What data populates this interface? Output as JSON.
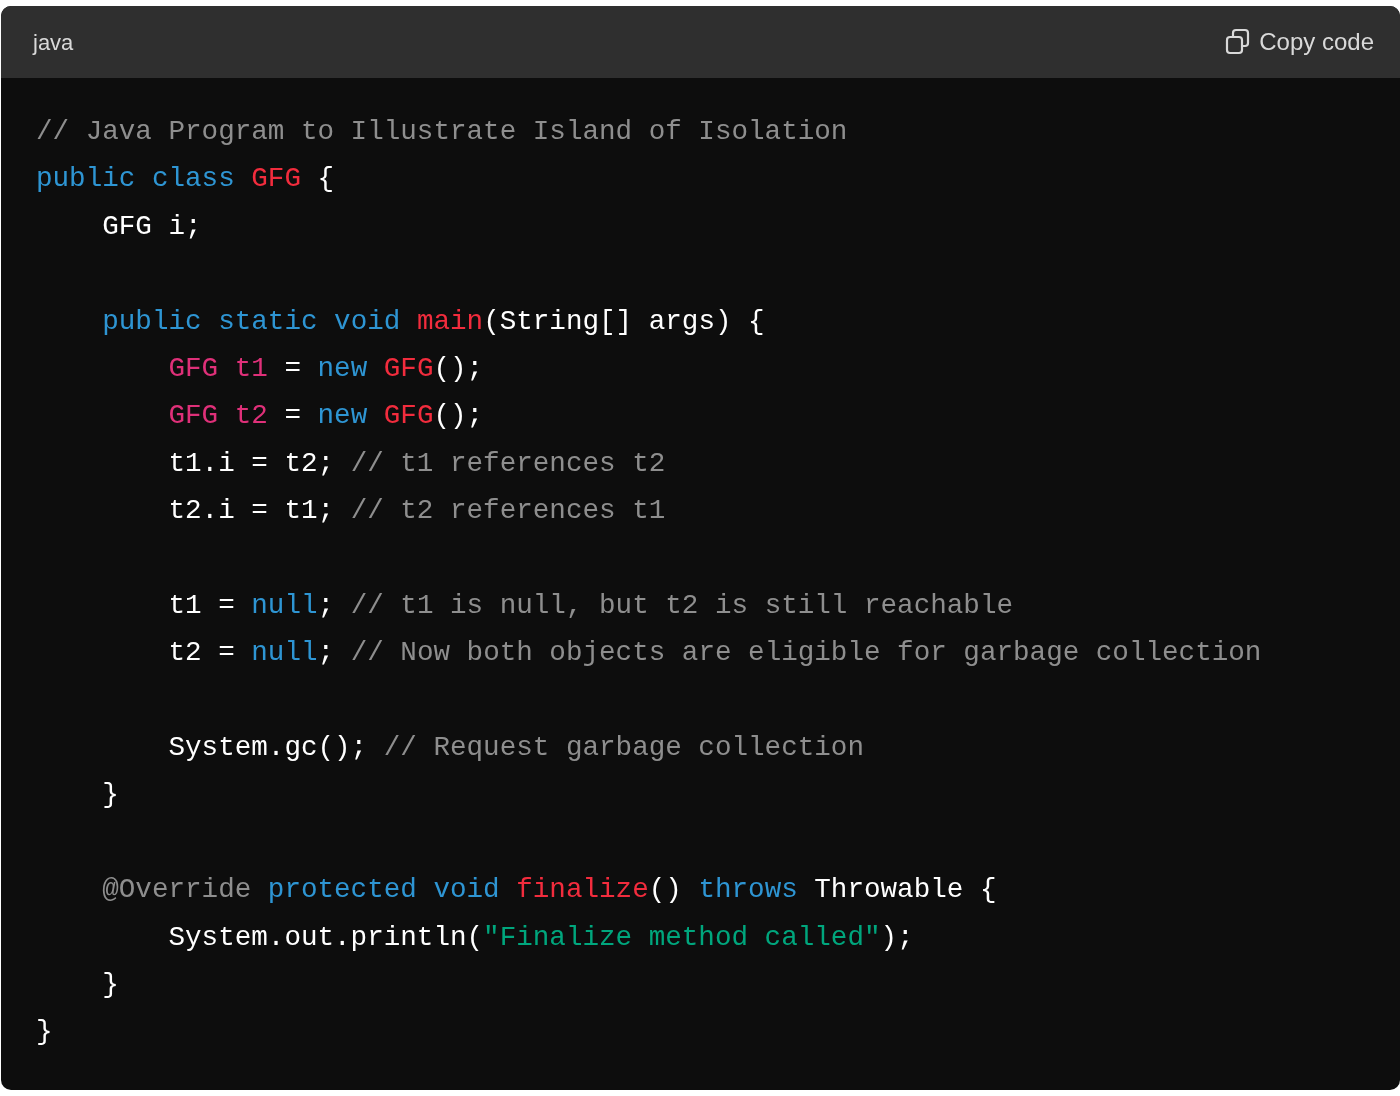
{
  "header": {
    "language": "java",
    "copy_button": "Copy code"
  },
  "code_lines": [
    {
      "kind": "code",
      "tokens": [
        {
          "kind": "comment",
          "text": "// Java Program to Illustrate Island of Isolation"
        }
      ]
    },
    {
      "kind": "code",
      "tokens": [
        {
          "kind": "keyword",
          "text": "public "
        },
        {
          "kind": "keyword",
          "text": "class "
        },
        {
          "kind": "name",
          "text": "GFG"
        },
        {
          "kind": "plain",
          "text": " {"
        }
      ]
    },
    {
      "kind": "code",
      "tokens": [
        {
          "kind": "plain",
          "text": "    GFG i;"
        }
      ]
    },
    {
      "kind": "blank"
    },
    {
      "kind": "code",
      "tokens": [
        {
          "kind": "keyword",
          "text": "    public "
        },
        {
          "kind": "keyword",
          "text": "static "
        },
        {
          "kind": "keyword",
          "text": "void "
        },
        {
          "kind": "name",
          "text": "main"
        },
        {
          "kind": "plain",
          "text": "(String[] args) {"
        }
      ]
    },
    {
      "kind": "code",
      "tokens": [
        {
          "kind": "variable",
          "text": "        GFG t1"
        },
        {
          "kind": "plain",
          "text": " = "
        },
        {
          "kind": "keyword",
          "text": "new "
        },
        {
          "kind": "name",
          "text": "GFG"
        },
        {
          "kind": "plain",
          "text": "();"
        }
      ]
    },
    {
      "kind": "code",
      "tokens": [
        {
          "kind": "variable",
          "text": "        GFG t2"
        },
        {
          "kind": "plain",
          "text": " = "
        },
        {
          "kind": "keyword",
          "text": "new "
        },
        {
          "kind": "name",
          "text": "GFG"
        },
        {
          "kind": "plain",
          "text": "();"
        }
      ]
    },
    {
      "kind": "code",
      "tokens": [
        {
          "kind": "plain",
          "text": "        t1.i = t2; "
        },
        {
          "kind": "comment",
          "text": "// t1 references t2"
        }
      ]
    },
    {
      "kind": "code",
      "tokens": [
        {
          "kind": "plain",
          "text": "        t2.i = t1; "
        },
        {
          "kind": "comment",
          "text": "// t2 references t1"
        }
      ]
    },
    {
      "kind": "blank"
    },
    {
      "kind": "code",
      "tokens": [
        {
          "kind": "plain",
          "text": "        t1 = "
        },
        {
          "kind": "keyword",
          "text": "null"
        },
        {
          "kind": "plain",
          "text": "; "
        },
        {
          "kind": "comment",
          "text": "// t1 is null, but t2 is still reachable"
        }
      ]
    },
    {
      "kind": "code",
      "tokens": [
        {
          "kind": "plain",
          "text": "        t2 = "
        },
        {
          "kind": "keyword",
          "text": "null"
        },
        {
          "kind": "plain",
          "text": "; "
        },
        {
          "kind": "comment",
          "text": "// Now both objects are eligible for garbage collection"
        }
      ]
    },
    {
      "kind": "blank"
    },
    {
      "kind": "code",
      "tokens": [
        {
          "kind": "plain",
          "text": "        System.gc(); "
        },
        {
          "kind": "comment",
          "text": "// Request garbage collection"
        }
      ]
    },
    {
      "kind": "code",
      "tokens": [
        {
          "kind": "plain",
          "text": "    }"
        }
      ]
    },
    {
      "kind": "blank"
    },
    {
      "kind": "code",
      "tokens": [
        {
          "kind": "comment",
          "text": "    @Override "
        },
        {
          "kind": "keyword",
          "text": "protected "
        },
        {
          "kind": "keyword",
          "text": "void "
        },
        {
          "kind": "name",
          "text": "finalize"
        },
        {
          "kind": "plain",
          "text": "() "
        },
        {
          "kind": "keyword",
          "text": "throws"
        },
        {
          "kind": "plain",
          "text": " Throwable {"
        }
      ]
    },
    {
      "kind": "code",
      "tokens": [
        {
          "kind": "plain",
          "text": "        System.out.println("
        },
        {
          "kind": "string",
          "text": "\"Finalize method called\""
        },
        {
          "kind": "plain",
          "text": ");"
        }
      ]
    },
    {
      "kind": "code",
      "tokens": [
        {
          "kind": "plain",
          "text": "    }"
        }
      ]
    },
    {
      "kind": "code",
      "tokens": [
        {
          "kind": "plain",
          "text": "}"
        }
      ]
    }
  ]
}
